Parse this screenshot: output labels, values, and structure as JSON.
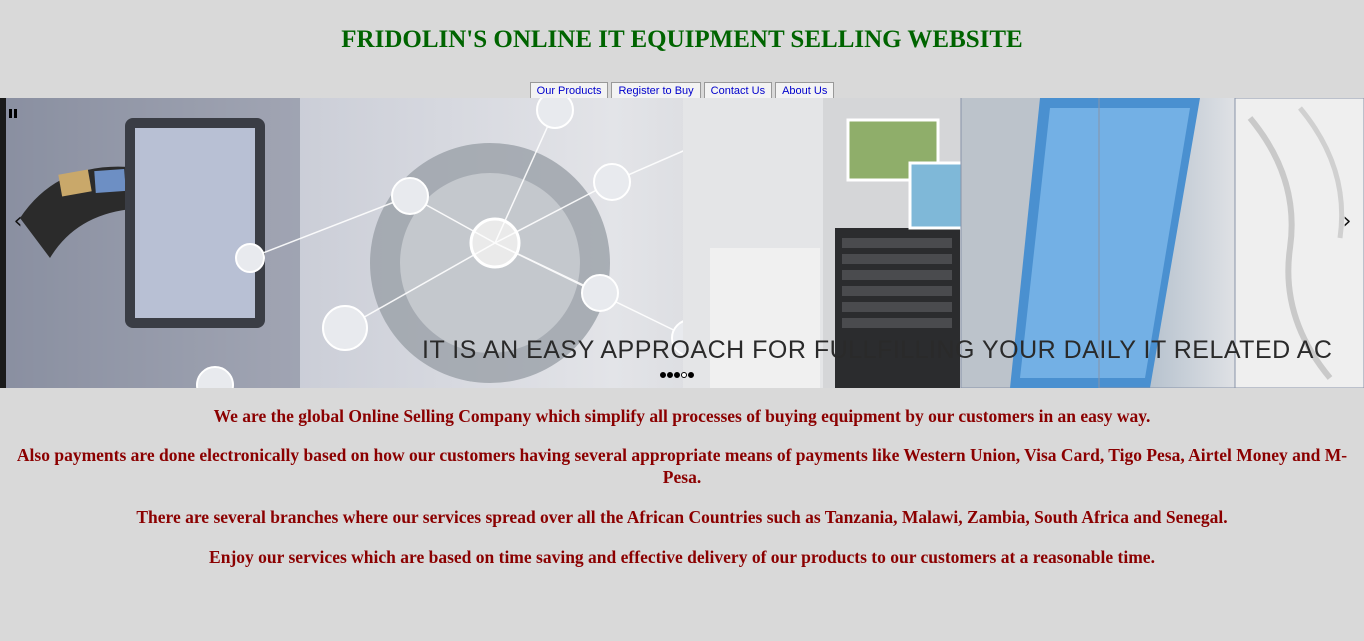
{
  "header": {
    "title": "FRIDOLIN'S ONLINE IT EQUIPMENT SELLING WEBSITE"
  },
  "nav": {
    "items": [
      {
        "label": "Our Products"
      },
      {
        "label": "Register to Buy"
      },
      {
        "label": "Contact Us"
      },
      {
        "label": "About Us"
      }
    ]
  },
  "slider": {
    "caption": "IT IS AN EASY APPROACH FOR FULLFILLING YOUR DAILY IT RELATED AC",
    "pause_icon": "pause-icon",
    "prev_icon": "chevron-left-icon",
    "next_icon": "chevron-right-icon",
    "prev_glyph": "‹",
    "next_glyph": "›",
    "slide_count": 5,
    "active_slide": 4
  },
  "content": {
    "paragraphs": [
      "We are the global Online Selling Company which simplify all processes of buying equipment by our customers in an easy way.",
      "Also payments are done electronically based on how our customers having several appropriate means of payments like Western Union, Visa Card, Tigo Pesa, Airtel Money and M-Pesa.",
      "There are several branches where our services spread over all the African Countries such as Tanzania, Malawi, Zambia, South Africa and Senegal.",
      "Enjoy our services which are based on time saving and effective delivery of our products to our customers at a reasonable time."
    ]
  },
  "colors": {
    "title": "#006400",
    "body_text": "#8b0000",
    "nav_text": "#0000cc",
    "background": "#d9d9d9"
  }
}
